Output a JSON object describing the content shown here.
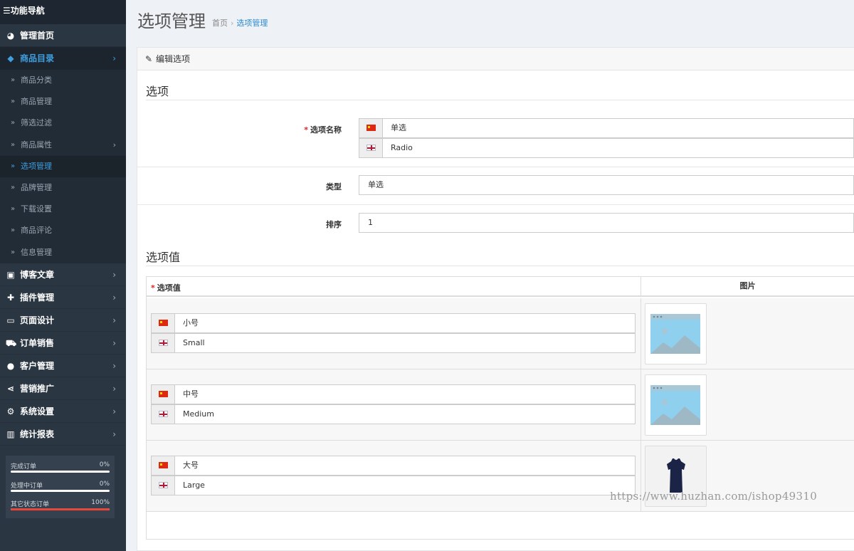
{
  "sidebar": {
    "header": "功能导航",
    "menu_icon": "bars-icon",
    "items": [
      {
        "label": "管理首页",
        "icon": "dashboard-icon"
      },
      {
        "label": "商品目录",
        "icon": "tags-icon"
      },
      {
        "label": "博客文章",
        "icon": "newspaper-icon"
      },
      {
        "label": "插件管理",
        "icon": "puzzle-icon"
      },
      {
        "label": "页面设计",
        "icon": "desktop-icon"
      },
      {
        "label": "订单销售",
        "icon": "cart-icon"
      },
      {
        "label": "客户管理",
        "icon": "user-icon"
      },
      {
        "label": "营销推广",
        "icon": "share-icon"
      },
      {
        "label": "系统设置",
        "icon": "gear-icon"
      },
      {
        "label": "统计报表",
        "icon": "bar-chart-icon"
      }
    ],
    "subitems": [
      "商品分类",
      "商品管理",
      "筛选过滤",
      "商品属性",
      "选项管理",
      "品牌管理",
      "下载设置",
      "商品评论",
      "信息管理"
    ],
    "stats": [
      {
        "label": "完成订单",
        "percent": "0%",
        "fill": 0
      },
      {
        "label": "处理中订单",
        "percent": "0%",
        "fill": 0
      },
      {
        "label": "其它状态订单",
        "percent": "100%",
        "fill": 100
      }
    ]
  },
  "page": {
    "title": "选项管理",
    "breadcrumb": {
      "home": "首页",
      "current": "选项管理"
    }
  },
  "panel": {
    "heading": "编辑选项",
    "section1": "选项",
    "name_label": "选项名称",
    "name_cn": "单选",
    "name_en": "Radio",
    "type_label": "类型",
    "type_value": "单选",
    "sort_label": "排序",
    "sort_value": "1",
    "section2": "选项值",
    "table": {
      "col1": "选项值",
      "col2": "图片",
      "rows": [
        {
          "cn": "小号",
          "en": "Small",
          "image": "placeholder"
        },
        {
          "cn": "中号",
          "en": "Medium",
          "image": "placeholder"
        },
        {
          "cn": "大号",
          "en": "Large",
          "image": "dress-photo"
        }
      ]
    }
  },
  "watermark": "https://www.huzhan.com/ishop49310",
  "colors": {
    "sidebar_bg": "#2b3643",
    "accent": "#3f9fe0",
    "required": "#e02222",
    "progress_fill": "#e8473c"
  }
}
